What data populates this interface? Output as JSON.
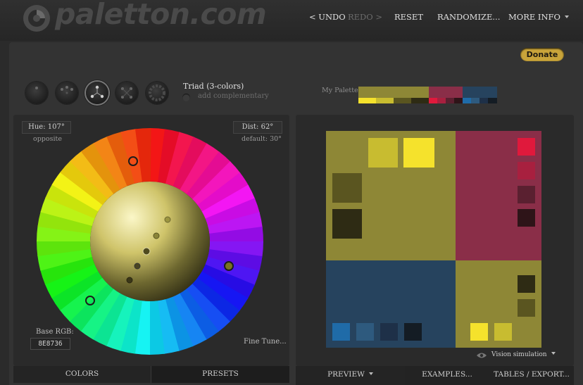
{
  "header": {
    "logo_text": "paletton.com",
    "nav": {
      "undo": "< UNDO",
      "redo": "REDO >",
      "reset": "RESET",
      "randomize": "RANDOMIZE...",
      "more_info": "MORE INFO"
    }
  },
  "donate_label": "Donate",
  "scheme": {
    "name": "Triad (3-colors)",
    "add_complementary": "add complementary",
    "modes": [
      "mono",
      "adjacent",
      "triad",
      "tetrad",
      "free"
    ],
    "active_mode": "triad"
  },
  "wheel": {
    "hue_label": "Hue: 107°",
    "opposite_label": "opposite",
    "dist_label": "Dist: 62°",
    "dist_default": "default: 30°",
    "base_rgb_label": "Base RGB:",
    "base_rgb_value": "8E8736",
    "fine_tune": "Fine Tune..."
  },
  "left_tabs": {
    "colors": "COLORS",
    "presets": "PRESETS"
  },
  "palette": {
    "label": "My Palette:",
    "primary": {
      "main": "#8E8736",
      "shades": [
        "#F5E22C",
        "#C8BC30",
        "#5A5520",
        "#2E2B14"
      ]
    },
    "secondary": {
      "main": "#8A2E48",
      "shades": [
        "#E0193C",
        "#A8203F",
        "#5A2030",
        "#2E1418"
      ]
    },
    "tertiary": {
      "main": "#26435E",
      "shades": [
        "#1F6BA8",
        "#2E5A7E",
        "#1E3048",
        "#141C24"
      ]
    }
  },
  "preview": {
    "vision_simulation": "Vision simulation"
  },
  "right_tabs": {
    "preview": "PREVIEW",
    "examples": "EXAMPLES...",
    "tables": "TABLES / EXPORT..."
  }
}
